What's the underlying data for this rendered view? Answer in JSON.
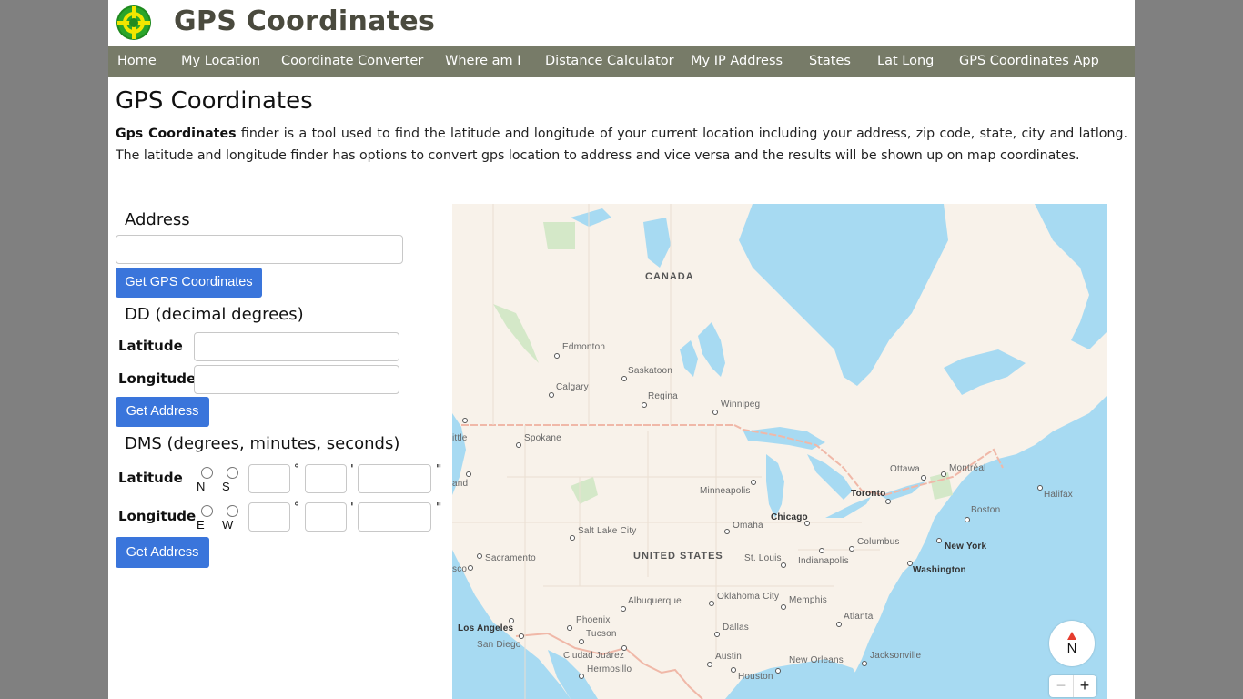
{
  "header": {
    "site_title": "GPS Coordinates",
    "logo_icon": "crosshair-target-icon"
  },
  "nav": {
    "items": [
      {
        "label": "Home"
      },
      {
        "label": "My Location"
      },
      {
        "label": "Coordinate Converter"
      },
      {
        "label": "Where am I"
      },
      {
        "label": "Distance Calculator"
      },
      {
        "label": "My IP Address"
      },
      {
        "label": "States"
      },
      {
        "label": "Lat Long"
      },
      {
        "label": "GPS Coordinates App"
      }
    ]
  },
  "main": {
    "title": "GPS Coordinates",
    "intro_bold": "Gps Coordinates",
    "intro_rest": " finder is a tool used to find the latitude and longitude of your current location including your address, zip code, state, city and latlong. The latitude and longitude finder has options to convert gps location to address and vice versa and the results will be shown up on map coordinates."
  },
  "form": {
    "address": {
      "heading": "Address",
      "value": "",
      "button": "Get GPS Coordinates"
    },
    "dd": {
      "heading": "DD (decimal degrees)",
      "latitude_label": "Latitude",
      "latitude_value": "",
      "longitude_label": "Longitude",
      "longitude_value": "",
      "button": "Get Address"
    },
    "dms": {
      "heading": "DMS (degrees, minutes, seconds)",
      "latitude_label": "Latitude",
      "lat_dir_options": [
        "N",
        "S"
      ],
      "longitude_label": "Longitude",
      "lon_dir_options": [
        "E",
        "W"
      ],
      "degree_symbol": "°",
      "minute_symbol": "'",
      "second_symbol": "\"",
      "button": "Get Address"
    }
  },
  "map": {
    "colors": {
      "land": "#f8f2ea",
      "water": "#a7daf2",
      "park": "#d4e8c8",
      "border": "#f0b8a8"
    },
    "countries": [
      {
        "label": "CANADA"
      },
      {
        "label": "UNITED STATES"
      }
    ],
    "cities": [
      {
        "label": "Edmonton"
      },
      {
        "label": "Saskatoon"
      },
      {
        "label": "Calgary"
      },
      {
        "label": "Regina"
      },
      {
        "label": "Winnipeg"
      },
      {
        "label": "Spokane"
      },
      {
        "label": "Minneapolis"
      },
      {
        "label": "Chicago"
      },
      {
        "label": "Omaha"
      },
      {
        "label": "Salt Lake City"
      },
      {
        "label": "Sacramento"
      },
      {
        "label": "St. Louis"
      },
      {
        "label": "Indianapolis"
      },
      {
        "label": "Columbus"
      },
      {
        "label": "Toronto"
      },
      {
        "label": "Ottawa"
      },
      {
        "label": "Montréal"
      },
      {
        "label": "Halifax"
      },
      {
        "label": "Boston"
      },
      {
        "label": "New York"
      },
      {
        "label": "Washington"
      },
      {
        "label": "Albuquerque"
      },
      {
        "label": "Oklahoma City"
      },
      {
        "label": "Memphis"
      },
      {
        "label": "Atlanta"
      },
      {
        "label": "Phoenix"
      },
      {
        "label": "Los Angeles"
      },
      {
        "label": "San Diego"
      },
      {
        "label": "Tucson"
      },
      {
        "label": "Dallas"
      },
      {
        "label": "Ciudad Juárez"
      },
      {
        "label": "Austin"
      },
      {
        "label": "New Orleans"
      },
      {
        "label": "Jacksonville"
      },
      {
        "label": "Hermosillo"
      },
      {
        "label": "Houston"
      },
      {
        "label": "ittle"
      },
      {
        "label": "and"
      },
      {
        "label": "sco"
      }
    ],
    "compass_label": "N",
    "zoom_out": "−",
    "zoom_in": "+"
  }
}
